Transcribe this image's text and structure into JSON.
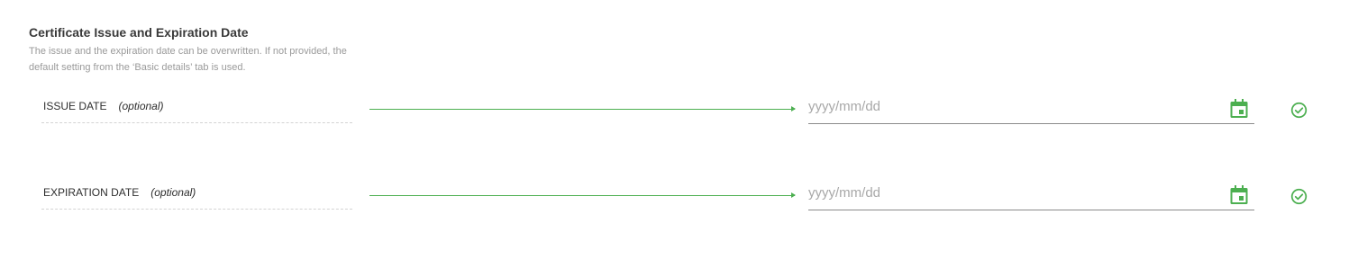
{
  "section": {
    "title": "Certificate Issue and Expiration Date",
    "description": "The issue and the expiration date can be overwritten. If not provided, the default setting from the ‘Basic details’ tab is used."
  },
  "fields": [
    {
      "label": "ISSUE DATE",
      "optional_label": "(optional)",
      "value": "",
      "placeholder": "yyyy/mm/dd"
    },
    {
      "label": "EXPIRATION DATE",
      "optional_label": "(optional)",
      "value": "",
      "placeholder": "yyyy/mm/dd"
    }
  ],
  "icons": {
    "calendar": "calendar-icon",
    "status": "check-circle-icon"
  },
  "colors": {
    "accent": "#4caf50",
    "title": "#3a3a3a",
    "muted_text": "#9a9a9a",
    "placeholder": "#a8a8a8"
  }
}
